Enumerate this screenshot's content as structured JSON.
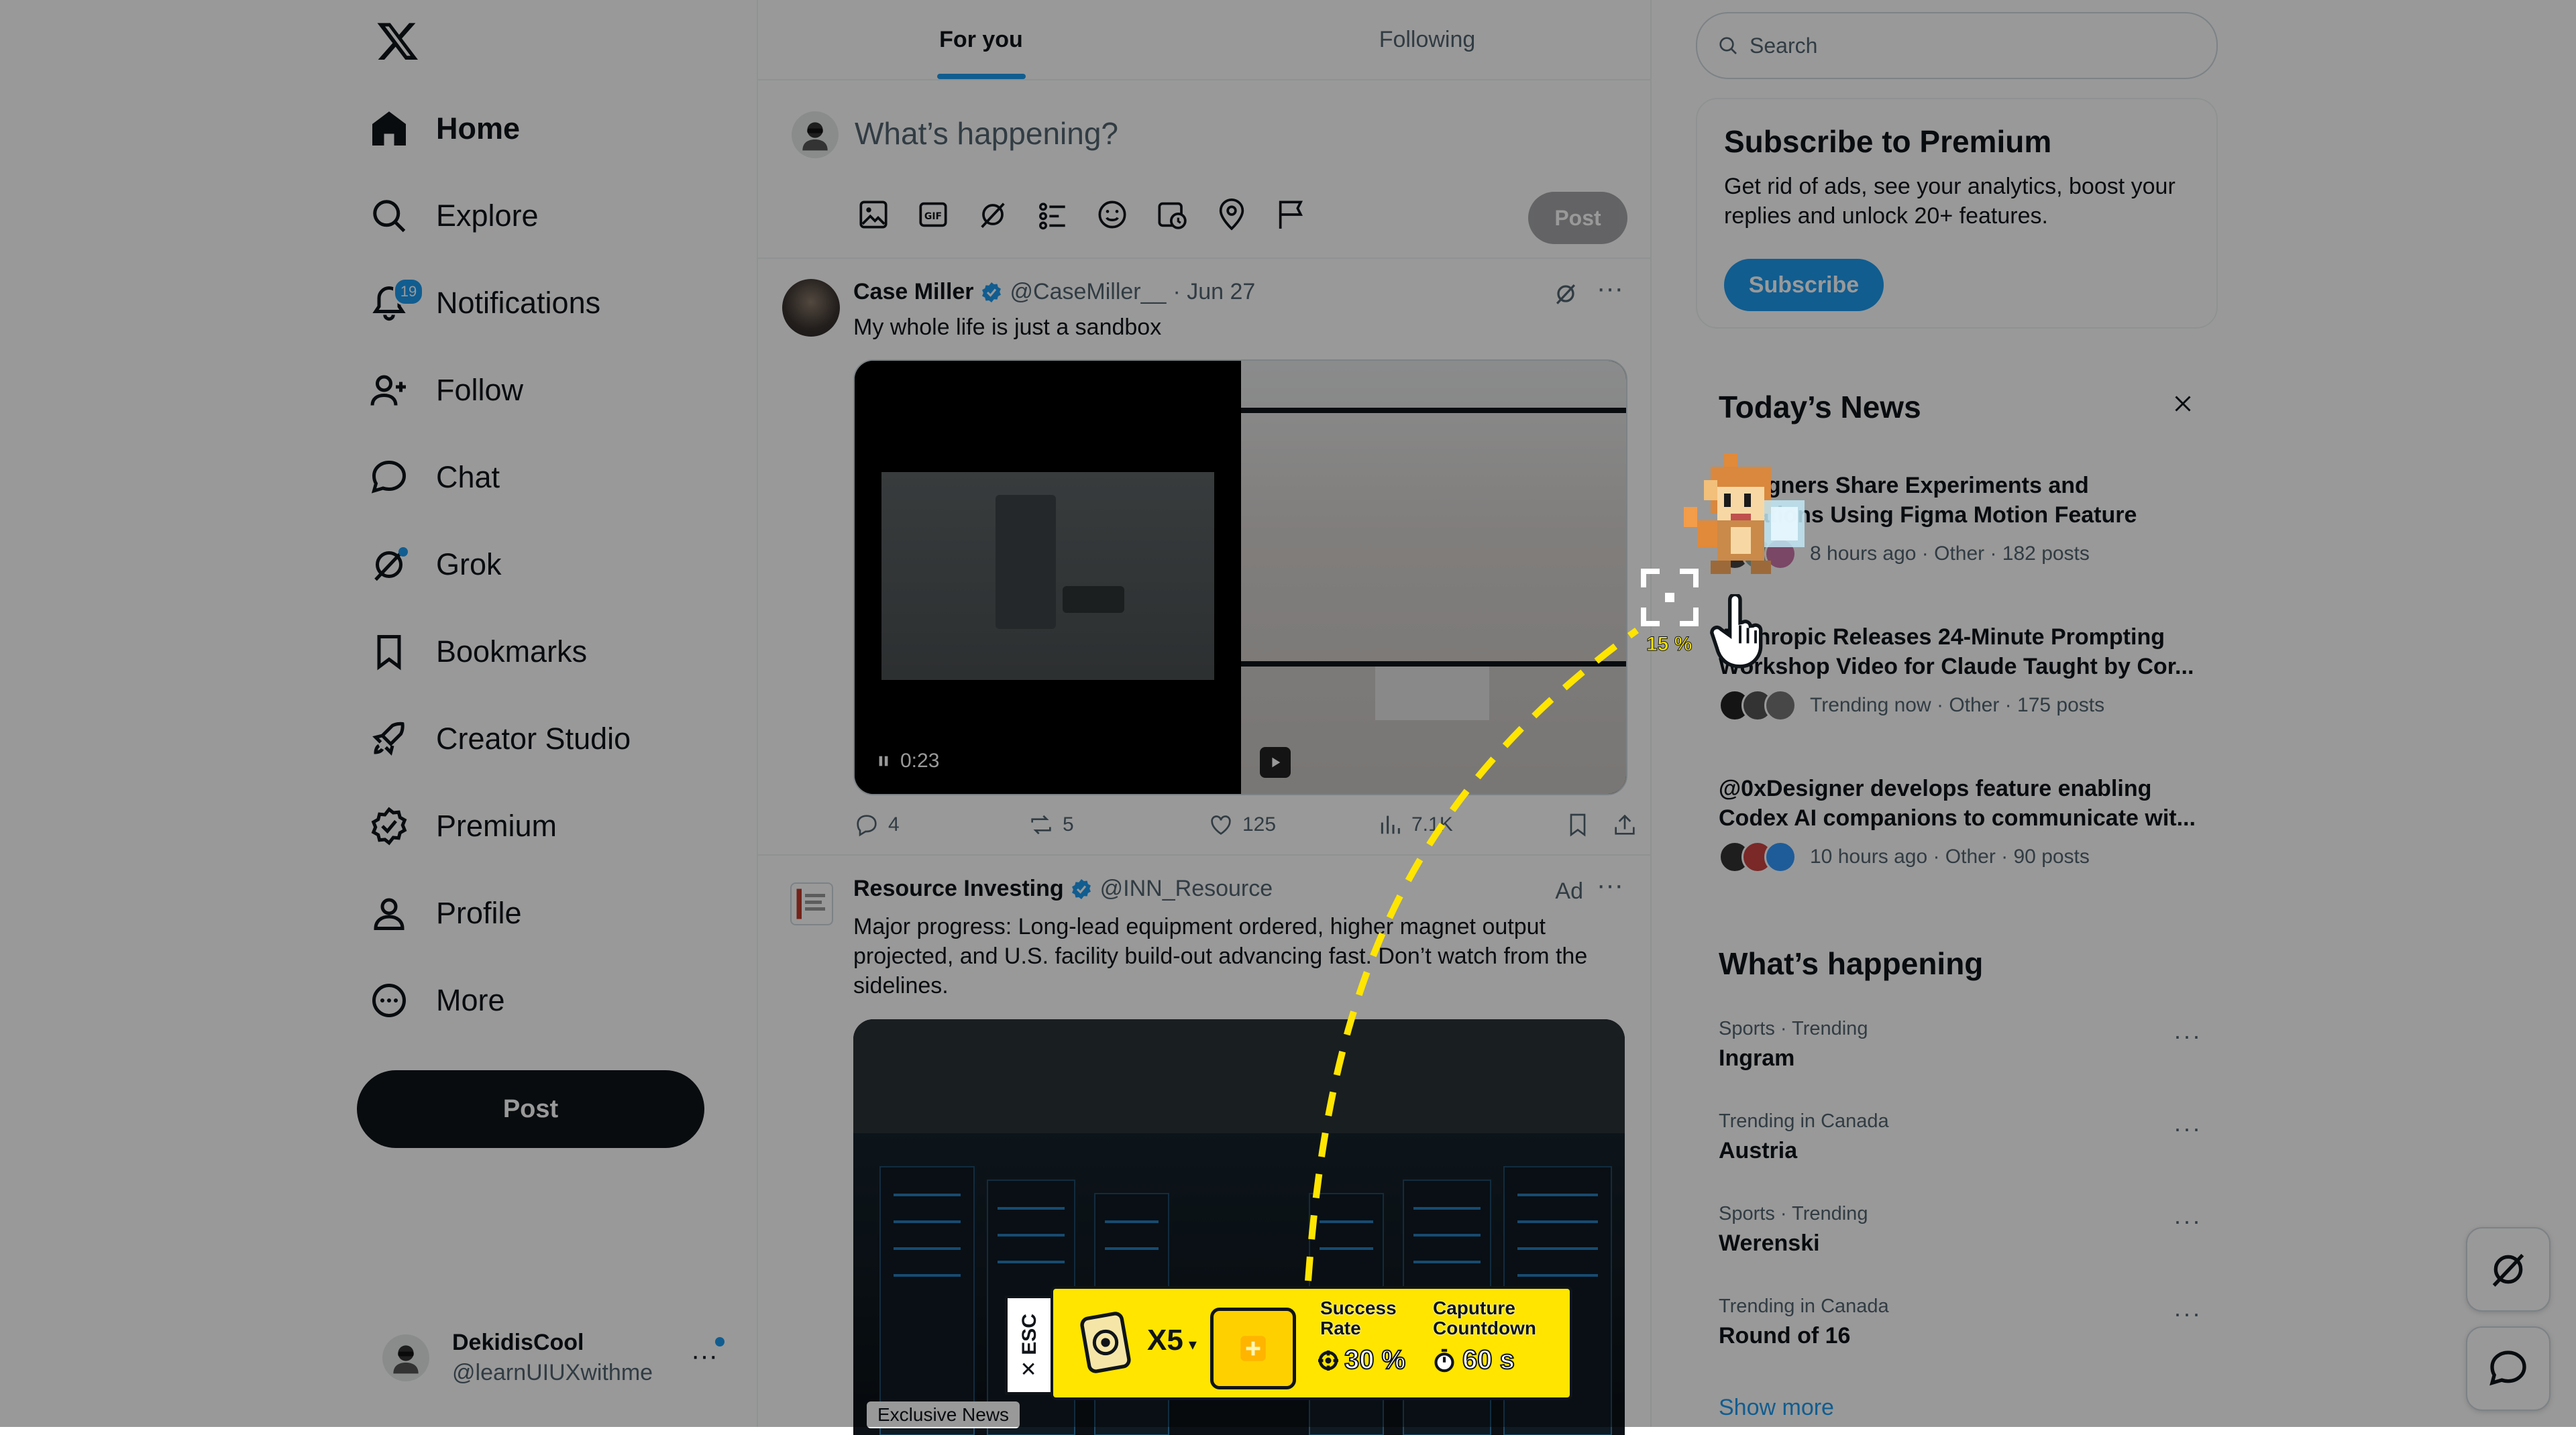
{
  "nav": {
    "items": [
      {
        "label": "Home",
        "icon": "home-icon"
      },
      {
        "label": "Explore",
        "icon": "search-icon"
      },
      {
        "label": "Notifications",
        "icon": "bell-icon",
        "badge": "19"
      },
      {
        "label": "Follow",
        "icon": "add-person-icon"
      },
      {
        "label": "Chat",
        "icon": "chat-bubble-icon"
      },
      {
        "label": "Grok",
        "icon": "grok-icon"
      },
      {
        "label": "Bookmarks",
        "icon": "bookmark-icon"
      },
      {
        "label": "Creator Studio",
        "icon": "rocket-icon"
      },
      {
        "label": "Premium",
        "icon": "verified-badge-icon"
      },
      {
        "label": "Profile",
        "icon": "person-icon"
      },
      {
        "label": "More",
        "icon": "more-circle-icon"
      }
    ],
    "post_label": "Post",
    "account": {
      "name": "DekidisCool",
      "handle": "@learnUIUXwithme"
    }
  },
  "feed": {
    "tabs": [
      "For you",
      "Following"
    ],
    "compose": {
      "placeholder": "What’s happening?",
      "post_label": "Post"
    },
    "tweets": [
      {
        "name": "Case Miller",
        "handle": "@CaseMiller__",
        "date": "· Jun 27",
        "text": "My whole life is just a sandbox",
        "video_time": "0:23",
        "replies": "4",
        "reposts": "5",
        "likes": "125",
        "views": "7.1K"
      },
      {
        "name": "Resource Investing",
        "handle": "@INN_Resource",
        "ad_label": "Ad",
        "text": "Major progress: Long-lead equipment ordered, higher magnet output projected, and U.S. facility build-out advancing fast. Don’t watch from the sidelines.",
        "media_label": "Exclusive News"
      }
    ]
  },
  "sidebar": {
    "search_placeholder": "Search",
    "premium": {
      "title": "Subscribe to Premium",
      "text": "Get rid of ads, see your analytics, boost your replies and unlock 20+ features.",
      "button": "Subscribe"
    },
    "news": {
      "title": "Today’s News",
      "items": [
        {
          "title1": "Designers Share Experiments and",
          "title2": "Creations Using Figma Motion Feature",
          "meta": "8 hours ago · Other · 182 posts"
        },
        {
          "title1": "Anthropic Releases 24-Minute Prompting",
          "title2": "Workshop Video for Claude Taught by Cor...",
          "meta": "Trending now · Other · 175 posts"
        },
        {
          "title1": "@0xDesigner develops feature enabling",
          "title2": "Codex AI companions to communicate wit...",
          "meta": "10 hours ago · Other · 90 posts"
        }
      ]
    },
    "happening": {
      "title": "What’s happening",
      "trends": [
        {
          "category": "Sports · Trending",
          "name": "Ingram"
        },
        {
          "category": "Trending in Canada",
          "name": "Austria"
        },
        {
          "category": "Sports · Trending",
          "name": "Werenski"
        },
        {
          "category": "Trending in Canada",
          "name": "Round of 16"
        }
      ],
      "show_more": "Show more"
    }
  },
  "overlay": {
    "capture_percent": "15 %",
    "esc_label": "ESC",
    "multiplier": "X5",
    "success_label_1": "Success",
    "success_label_2": "Rate",
    "success_value": "30 %",
    "countdown_label_1": "Caputure",
    "countdown_label_2": "Countdown",
    "countdown_value": "60 s"
  },
  "colors": {
    "accent": "#1d9bf0",
    "text": "#0f1419",
    "muted": "#536471",
    "hud_yellow": "#ffe500"
  }
}
